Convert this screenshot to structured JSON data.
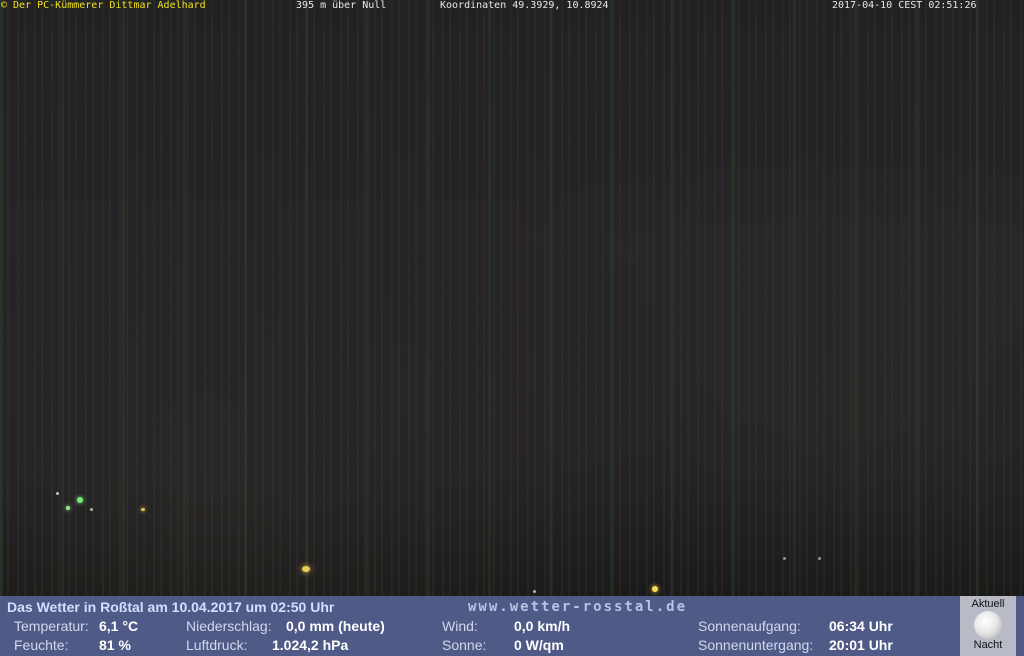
{
  "overlay": {
    "copyright": "© Der PC-Kümmerer Dittmar Adelhard",
    "altitude": "395 m über Null",
    "coordinates": "Koordinaten 49.3929, 10.8924",
    "timestamp": "2017-04-10 CEST 02:51:26"
  },
  "weather": {
    "title": "Das Wetter in Roßtal am 10.04.2017 um 02:50 Uhr",
    "url": "www.wetter-rosstal.de",
    "temperature_label": "Temperatur:",
    "temperature_value": "6,1 °C",
    "humidity_label": "Feuchte:",
    "humidity_value": "81 %",
    "precipitation_label": "Niederschlag:",
    "precipitation_value": "0,0 mm (heute)",
    "pressure_label": "Luftdruck:",
    "pressure_value": "1.024,2 hPa",
    "wind_label": "Wind:",
    "wind_value": "0,0 km/h",
    "sun_label": "Sonne:",
    "sun_value": "0 W/qm",
    "sunrise_label": "Sonnenaufgang:",
    "sunrise_value": "06:34 Uhr",
    "sunset_label": "Sonnenuntergang:",
    "sunset_value": "20:01 Uhr"
  },
  "moon": {
    "caption_top": "Aktuell",
    "caption_bottom": "Nacht",
    "icon": "full-moon-icon"
  },
  "colors": {
    "overlay_text": "#f0e020",
    "overlay_text_secondary": "#e8e8e8",
    "panel_background": "#505a86",
    "light_green": "#7dff7d",
    "light_yellow": "#ffe05a"
  }
}
